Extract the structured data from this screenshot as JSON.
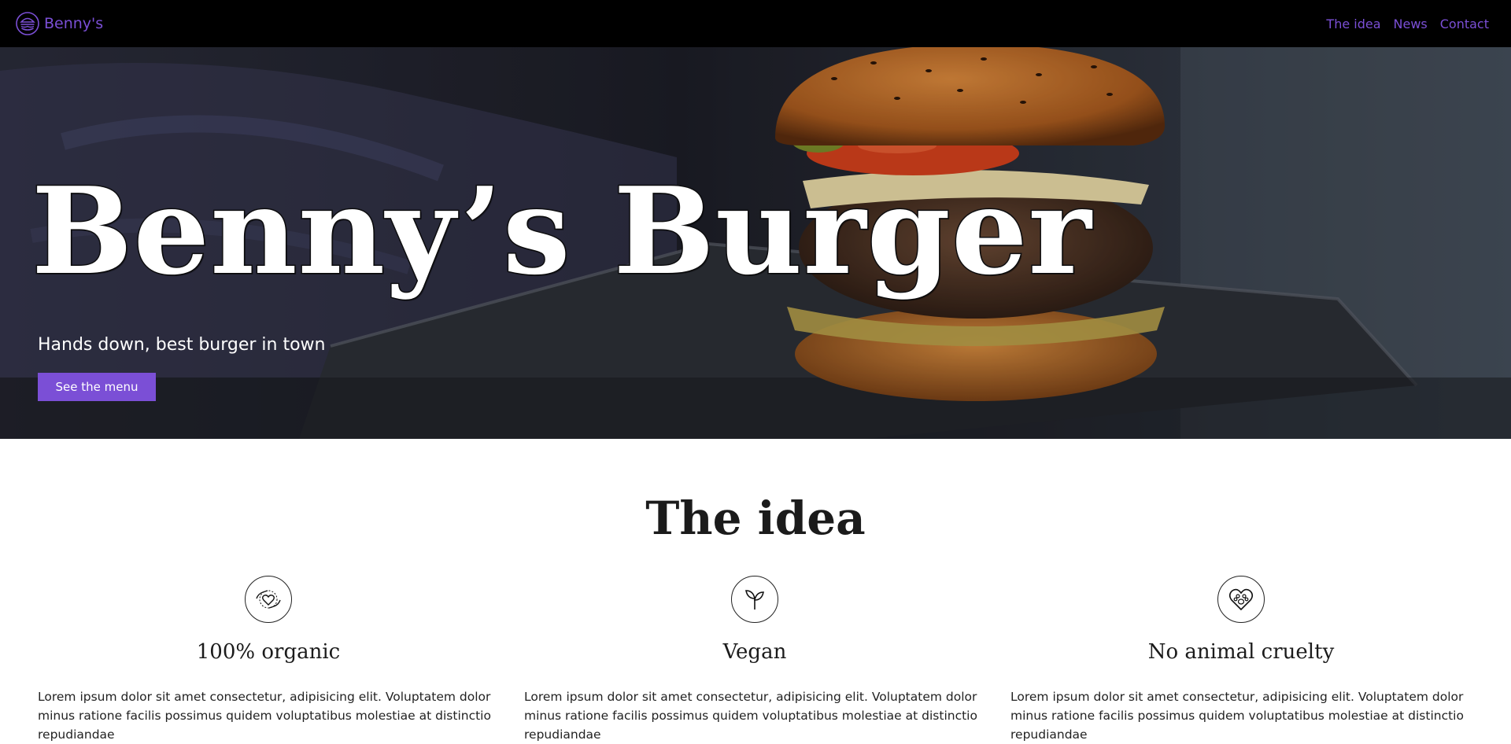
{
  "nav": {
    "brand_icon": "burger-icon",
    "brand_name": "Benny's",
    "links": [
      {
        "label": "The idea"
      },
      {
        "label": "News"
      },
      {
        "label": "Contact"
      }
    ]
  },
  "hero": {
    "background_image": "burger-photo",
    "title": "Benny’s Burger",
    "subtitle": "Hands down, best burger in town",
    "cta_label": "See the menu"
  },
  "idea": {
    "title": "The idea",
    "features": [
      {
        "icon": "heart-hands-icon",
        "title": "100% organic",
        "text": "Lorem ipsum dolor sit amet consectetur, adipisicing elit. Voluptatem dolor minus ratione facilis possimus quidem voluptatibus molestiae at distinctio repudiandae"
      },
      {
        "icon": "sprout-icon",
        "title": "Vegan",
        "text": "Lorem ipsum dolor sit amet consectetur, adipisicing elit. Voluptatem dolor minus ratione facilis possimus quidem voluptatibus molestiae at distinctio repudiandae"
      },
      {
        "icon": "paw-heart-icon",
        "title": "No animal cruelty",
        "text": "Lorem ipsum dolor sit amet consectetur, adipisicing elit. Voluptatem dolor minus ratione facilis possimus quidem voluptatibus molestiae at distinctio repudiandae"
      }
    ]
  },
  "colors": {
    "accent": "#7b4fd6",
    "nav_background": "#000000",
    "hero_text": "#ffffff"
  }
}
